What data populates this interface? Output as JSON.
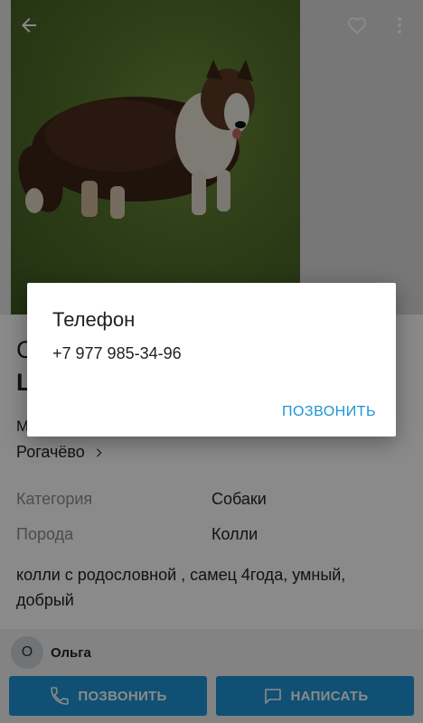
{
  "listing": {
    "title_line1": "С",
    "title_line2": "L",
    "location_label": "М",
    "location_value": "Рогачёво",
    "attributes": [
      {
        "key": "Категория",
        "value": "Собаки"
      },
      {
        "key": "Порода",
        "value": "Колли"
      }
    ],
    "description": "колли с родословной , самец 4года, умный, добрый"
  },
  "seller": {
    "avatar_letter": "О",
    "name": "Ольга"
  },
  "actions": {
    "call_label": "ПОЗВОНИТЬ",
    "message_label": "НАПИСАТЬ"
  },
  "dialog": {
    "title": "Телефон",
    "phone": "+7 977 985-34-96",
    "call_button": "ПОЗВОНИТЬ"
  },
  "colors": {
    "accent": "#1e94d6",
    "scrim": "rgba(0,0,0,0.46)"
  },
  "icons": {
    "back": "arrow-left-icon",
    "favorite": "heart-icon",
    "more": "more-vertical-icon",
    "chevron": "chevron-right-icon",
    "phone": "phone-icon",
    "chat": "chat-icon"
  }
}
